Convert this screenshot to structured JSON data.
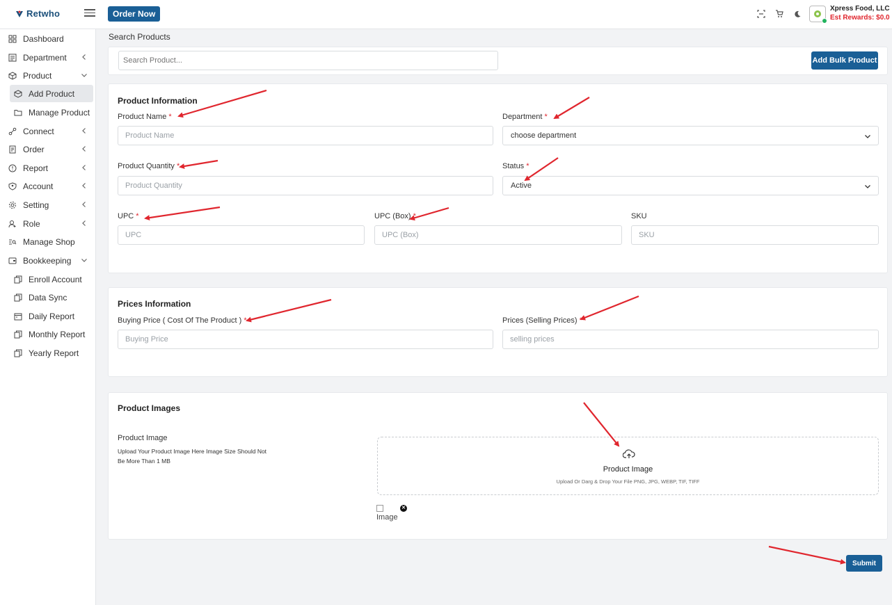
{
  "header": {
    "brand": "Retwho",
    "order_now": "Order Now",
    "user_name": "Xpress Food, LLC",
    "rewards": "Est Rewards: $0.0"
  },
  "sidebar": {
    "items": [
      {
        "label": "Dashboard",
        "icon": "grid-icon"
      },
      {
        "label": "Department",
        "icon": "department-icon"
      },
      {
        "label": "Product",
        "icon": "box-icon"
      },
      {
        "label": "Add Product",
        "icon": "add-box-icon"
      },
      {
        "label": "Manage Product",
        "icon": "folder-icon"
      },
      {
        "label": "Connect",
        "icon": "connect-icon"
      },
      {
        "label": "Order",
        "icon": "order-icon"
      },
      {
        "label": "Report",
        "icon": "report-icon"
      },
      {
        "label": "Account",
        "icon": "account-icon"
      },
      {
        "label": "Setting",
        "icon": "gear-icon"
      },
      {
        "label": "Role",
        "icon": "role-icon"
      },
      {
        "label": "Manage Shop",
        "icon": "shop-search-icon"
      },
      {
        "label": "Bookkeeping",
        "icon": "wallet-icon"
      },
      {
        "label": "Enroll Account",
        "icon": "copy-icon"
      },
      {
        "label": "Data Sync",
        "icon": "sync-icon"
      },
      {
        "label": "Daily Report",
        "icon": "calendar-icon"
      },
      {
        "label": "Monthly Report",
        "icon": "copy-icon"
      },
      {
        "label": "Yearly Report",
        "icon": "copy-icon"
      }
    ]
  },
  "search": {
    "title": "Search Products",
    "placeholder": "Search Product...",
    "bulk_button": "Add Bulk Product"
  },
  "product_info": {
    "title": "Product Information",
    "name_label": "Product Name",
    "name_placeholder": "Product Name",
    "department_label": "Department",
    "department_value": "choose department",
    "quantity_label": "Product Quantity",
    "quantity_placeholder": "Product Quantity",
    "status_label": "Status",
    "status_value": "Active",
    "upc_label": "UPC",
    "upc_placeholder": "UPC",
    "upc_box_label": "UPC (Box)",
    "upc_box_placeholder": "UPC (Box)",
    "sku_label": "SKU",
    "sku_placeholder": "SKU",
    "required_mark": "*"
  },
  "prices": {
    "title": "Prices Information",
    "buying_label": "Buying Price ( Cost Of The Product )",
    "buying_placeholder": "Buying Price",
    "selling_label": "Prices (Selling Prices)",
    "selling_placeholder": "selling prices"
  },
  "images": {
    "title": "Product Images",
    "field_label": "Product Image",
    "help_line1": "Upload Your Product Image Here Image Size Should Not",
    "help_line2": "Be More Than 1 MB",
    "upload_title": "Product Image",
    "upload_sub": "Upload Or Darg & Drop Your File PNG, JPG, WEBP, TIF, TIFF",
    "preview_alt": "Image"
  },
  "submit": "Submit",
  "colors": {
    "primary": "#1a5f96",
    "required": "#e0262e",
    "annotation_arrow": "#e0262e"
  }
}
